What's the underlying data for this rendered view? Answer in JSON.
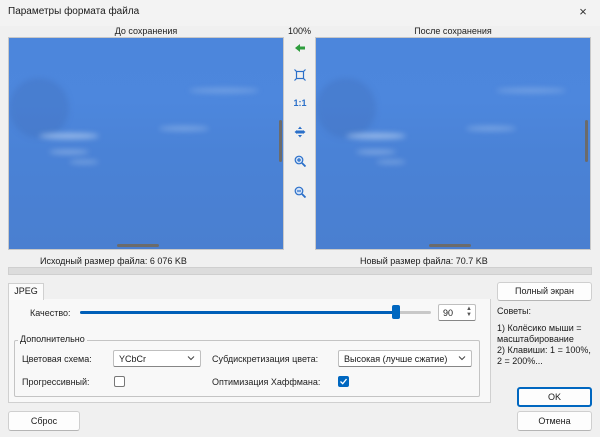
{
  "window": {
    "title": "Параметры формата файла",
    "close_icon": "×"
  },
  "preview": {
    "before_label": "До сохранения",
    "after_label": "После сохранения",
    "zoom_label": "100%",
    "original_size_text": "Исходный размер файла:  6 076 KB",
    "new_size_text": "Новый размер файла:   70.7 KB"
  },
  "tools": [
    "back-arrow-icon",
    "fit-window-icon",
    "actual-size-icon",
    "pan-icon",
    "zoom-in-icon",
    "zoom-out-icon"
  ],
  "tools_labels": {
    "actual_size": "1:1"
  },
  "tabs": [
    {
      "label": "JPEG"
    }
  ],
  "quality": {
    "label": "Качество:",
    "value": "90",
    "percent": 90
  },
  "advanced": {
    "title": "Дополнительно",
    "color_scheme_label": "Цветовая схема:",
    "color_scheme_value": "YCbCr",
    "subsampling_label": "Субдискретизация цвета:",
    "subsampling_value": "Высокая (лучше сжатие)",
    "progressive_label": "Прогрессивный:",
    "progressive_checked": false,
    "huffman_label": "Оптимизация Хаффмана:",
    "huffman_checked": true
  },
  "buttons": {
    "fullscreen": "Полный экран",
    "ok": "OK",
    "cancel": "Отмена",
    "reset": "Сброс"
  },
  "tips": {
    "title": "Советы:",
    "line1": "1) Колёсико мыши = масштабирование",
    "line2": "2) Клавиши: 1 = 100%, 2 = 200%..."
  },
  "colors": {
    "accent": "#0067c0",
    "sky": "#4c86dc",
    "green_icon": "#2e9d3c",
    "tool_blue": "#2a6fc9"
  }
}
